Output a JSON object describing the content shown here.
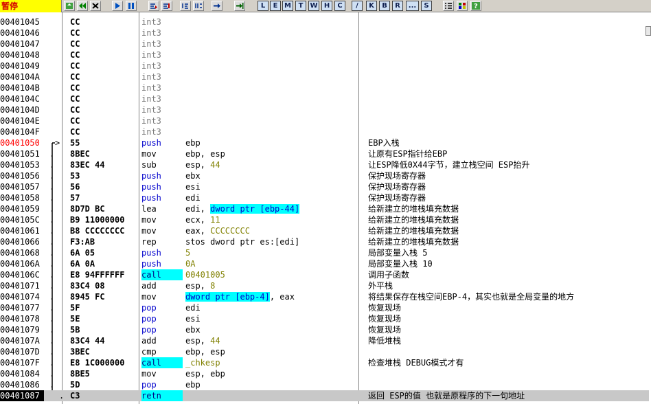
{
  "status": "暂停",
  "toolbar": {
    "letters": [
      "L",
      "E",
      "M",
      "T",
      "W",
      "H",
      "C",
      "/",
      "K",
      "B",
      "R",
      "...",
      "S"
    ]
  },
  "rows": [
    {
      "addr": "00401045",
      "mk": "",
      "hex": "CC",
      "mn": "int3",
      "ops": [],
      "cm": "",
      "style": "grey"
    },
    {
      "addr": "00401046",
      "mk": "",
      "hex": "CC",
      "mn": "int3",
      "ops": [],
      "cm": "",
      "style": "grey"
    },
    {
      "addr": "00401047",
      "mk": "",
      "hex": "CC",
      "mn": "int3",
      "ops": [],
      "cm": "",
      "style": "grey"
    },
    {
      "addr": "00401048",
      "mk": "",
      "hex": "CC",
      "mn": "int3",
      "ops": [],
      "cm": "",
      "style": "grey"
    },
    {
      "addr": "00401049",
      "mk": "",
      "hex": "CC",
      "mn": "int3",
      "ops": [],
      "cm": "",
      "style": "grey"
    },
    {
      "addr": "0040104A",
      "mk": "",
      "hex": "CC",
      "mn": "int3",
      "ops": [],
      "cm": "",
      "style": "grey"
    },
    {
      "addr": "0040104B",
      "mk": "",
      "hex": "CC",
      "mn": "int3",
      "ops": [],
      "cm": "",
      "style": "grey"
    },
    {
      "addr": "0040104C",
      "mk": "",
      "hex": "CC",
      "mn": "int3",
      "ops": [],
      "cm": "",
      "style": "grey"
    },
    {
      "addr": "0040104D",
      "mk": "",
      "hex": "CC",
      "mn": "int3",
      "ops": [],
      "cm": "",
      "style": "grey"
    },
    {
      "addr": "0040104E",
      "mk": "",
      "hex": "CC",
      "mn": "int3",
      "ops": [],
      "cm": "",
      "style": "grey"
    },
    {
      "addr": "0040104F",
      "mk": "",
      "hex": "CC",
      "mn": "int3",
      "ops": [],
      "cm": "",
      "style": "grey"
    },
    {
      "addr": "00401050",
      "mk": ">",
      "hex": "55",
      "mn": "push",
      "ops": [
        {
          "t": "ebp",
          "k": "o"
        }
      ],
      "cm": "EBP入栈",
      "style": "blue",
      "hi": true
    },
    {
      "addr": "00401051",
      "mk": ".",
      "hex": "8BEC",
      "mn": "mov",
      "ops": [
        {
          "t": "ebp, esp",
          "k": "o"
        }
      ],
      "cm": "让原有ESP指针给EBP",
      "style": ""
    },
    {
      "addr": "00401053",
      "mk": ".",
      "hex": "83EC 44",
      "mn": "sub",
      "ops": [
        {
          "t": "esp, ",
          "k": "o"
        },
        {
          "t": "44",
          "k": "n"
        }
      ],
      "cm": "让ESP降低0X44字节，建立栈空间 ESP抬升",
      "style": ""
    },
    {
      "addr": "00401056",
      "mk": ".",
      "hex": "53",
      "mn": "push",
      "ops": [
        {
          "t": "ebx",
          "k": "o"
        }
      ],
      "cm": "保护现场寄存器",
      "style": "blue"
    },
    {
      "addr": "00401057",
      "mk": ".",
      "hex": "56",
      "mn": "push",
      "ops": [
        {
          "t": "esi",
          "k": "o"
        }
      ],
      "cm": "保护现场寄存器",
      "style": "blue"
    },
    {
      "addr": "00401058",
      "mk": ".",
      "hex": "57",
      "mn": "push",
      "ops": [
        {
          "t": "edi",
          "k": "o"
        }
      ],
      "cm": "保护现场寄存器",
      "style": "blue"
    },
    {
      "addr": "00401059",
      "mk": ".",
      "hex": "8D7D BC",
      "mn": "lea",
      "ops": [
        {
          "t": "edi, ",
          "k": "o"
        },
        {
          "t": "dword ptr [ebp-44]",
          "k": "m"
        }
      ],
      "cm": "给新建立的堆栈填充数据",
      "style": ""
    },
    {
      "addr": "0040105C",
      "mk": ".",
      "hex": "B9 11000000",
      "mn": "mov",
      "ops": [
        {
          "t": "ecx, ",
          "k": "o"
        },
        {
          "t": "11",
          "k": "n"
        }
      ],
      "cm": "给新建立的堆栈填充数据",
      "style": ""
    },
    {
      "addr": "00401061",
      "mk": ".",
      "hex": "B8 CCCCCCCC",
      "mn": "mov",
      "ops": [
        {
          "t": "eax, ",
          "k": "o"
        },
        {
          "t": "CCCCCCCC",
          "k": "n"
        }
      ],
      "cm": "给新建立的堆栈填充数据",
      "style": ""
    },
    {
      "addr": "00401066",
      "mk": ".",
      "hex": "F3:AB",
      "mn": "rep",
      "ops": [
        {
          "t": "stos dword ptr es:[edi]",
          "k": "o"
        }
      ],
      "cm": "给新建立的堆栈填充数据",
      "style": ""
    },
    {
      "addr": "00401068",
      "mk": ".",
      "hex": "6A 05",
      "mn": "push",
      "ops": [
        {
          "t": "5",
          "k": "n"
        }
      ],
      "cm": "局部变量入栈  5",
      "style": "blue"
    },
    {
      "addr": "0040106A",
      "mk": ".",
      "hex": "6A 0A",
      "mn": "push",
      "ops": [
        {
          "t": "0A",
          "k": "n"
        }
      ],
      "cm": "局部变量入栈 10",
      "style": "blue"
    },
    {
      "addr": "0040106C",
      "mk": ".",
      "hex": "E8 94FFFFFF",
      "mn": "call",
      "ops": [
        {
          "t": "00401005",
          "k": "n"
        }
      ],
      "cm": "调用子函数",
      "style": "bluebg"
    },
    {
      "addr": "00401071",
      "mk": ".",
      "hex": "83C4 08",
      "mn": "add",
      "ops": [
        {
          "t": "esp, ",
          "k": "o"
        },
        {
          "t": "8",
          "k": "n"
        }
      ],
      "cm": "外平栈",
      "style": ""
    },
    {
      "addr": "00401074",
      "mk": ".",
      "hex": "8945 FC",
      "mn": "mov",
      "ops": [
        {
          "t": "dword ptr [ebp-4]",
          "k": "m"
        },
        {
          "t": ", eax",
          "k": "o"
        }
      ],
      "cm": "将结果保存在栈空间EBP-4，其实也就是全局变量的地方",
      "style": ""
    },
    {
      "addr": "00401077",
      "mk": ".",
      "hex": "5F",
      "mn": "pop",
      "ops": [
        {
          "t": "edi",
          "k": "o"
        }
      ],
      "cm": "恢复现场",
      "style": "blue"
    },
    {
      "addr": "00401078",
      "mk": ".",
      "hex": "5E",
      "mn": "pop",
      "ops": [
        {
          "t": "esi",
          "k": "o"
        }
      ],
      "cm": "恢复现场",
      "style": "blue"
    },
    {
      "addr": "00401079",
      "mk": ".",
      "hex": "5B",
      "mn": "pop",
      "ops": [
        {
          "t": "ebx",
          "k": "o"
        }
      ],
      "cm": "恢复现场",
      "style": "blue"
    },
    {
      "addr": "0040107A",
      "mk": ".",
      "hex": "83C4 44",
      "mn": "add",
      "ops": [
        {
          "t": "esp, ",
          "k": "o"
        },
        {
          "t": "44",
          "k": "n"
        }
      ],
      "cm": "降低堆栈",
      "style": ""
    },
    {
      "addr": "0040107D",
      "mk": ".",
      "hex": "3BEC",
      "mn": "cmp",
      "ops": [
        {
          "t": "ebp, esp",
          "k": "o"
        }
      ],
      "cm": "",
      "style": ""
    },
    {
      "addr": "0040107F",
      "mk": ".",
      "hex": "E8 1C000000",
      "mn": "call",
      "ops": [
        {
          "t": "_chkesp",
          "k": "n"
        }
      ],
      "cm": "检查堆栈 DEBUG模式才有",
      "style": "bluebg"
    },
    {
      "addr": "00401084",
      "mk": ".",
      "hex": "8BE5",
      "mn": "mov",
      "ops": [
        {
          "t": "esp, ebp",
          "k": "o"
        }
      ],
      "cm": "",
      "style": ""
    },
    {
      "addr": "00401086",
      "mk": ".",
      "hex": "5D",
      "mn": "pop",
      "ops": [
        {
          "t": "ebp",
          "k": "o"
        }
      ],
      "cm": "",
      "style": "blue"
    },
    {
      "addr": "00401087",
      "mk": "L.",
      "hex": "C3",
      "mn": "retn",
      "ops": [],
      "cm": "返回 ESP的值 也就是原程序的下一句地址",
      "style": "bluebg",
      "sel": true
    }
  ]
}
